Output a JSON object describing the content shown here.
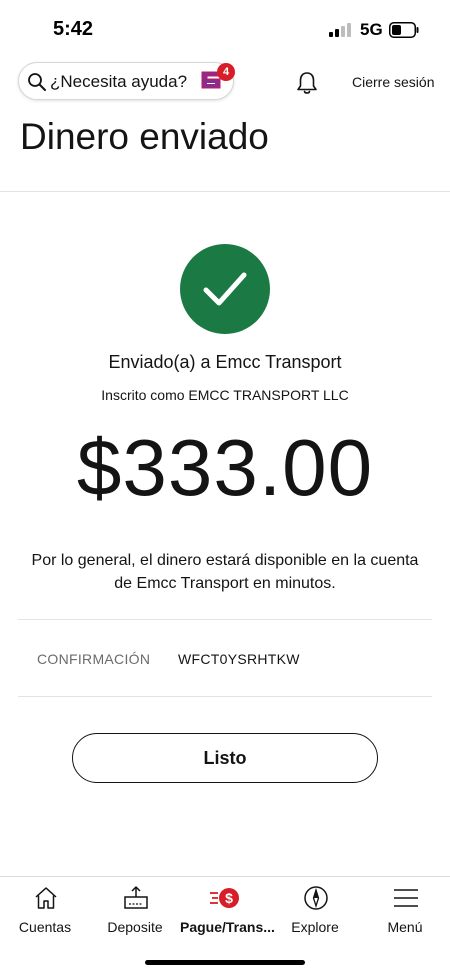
{
  "status_bar": {
    "time": "5:42",
    "network": "5G"
  },
  "header": {
    "search_placeholder": "¿Necesita ayuda?",
    "assistant_badge_count": "4",
    "signout_label": "Cierre sesión"
  },
  "page": {
    "title": "Dinero enviado",
    "recipient_line": "Enviado(a) a Emcc Transport",
    "enrolled_line": "Inscrito como EMCC TRANSPORT LLC",
    "amount": "$333.00",
    "availability_line1": "Por lo general, el dinero estará disponible en la cuenta",
    "availability_line2": "de Emcc Transport en minutos.",
    "confirmation_label": "CONFIRMACIÓN",
    "confirmation_value": "WFCT0YSRHTKW",
    "done_button": "Listo"
  },
  "bottom_nav": [
    {
      "label": "Cuentas",
      "icon": "home-icon"
    },
    {
      "label": "Deposite",
      "icon": "deposit-icon"
    },
    {
      "label": "Pague/Trans...",
      "icon": "pay-transfer-icon",
      "active": true
    },
    {
      "label": "Explore",
      "icon": "compass-icon"
    },
    {
      "label": "Menú",
      "icon": "hamburger-menu-icon"
    }
  ],
  "colors": {
    "success": "#1b7a44",
    "brand_red": "#d71e28",
    "text": "#141414",
    "muted": "#6b6b6b"
  }
}
